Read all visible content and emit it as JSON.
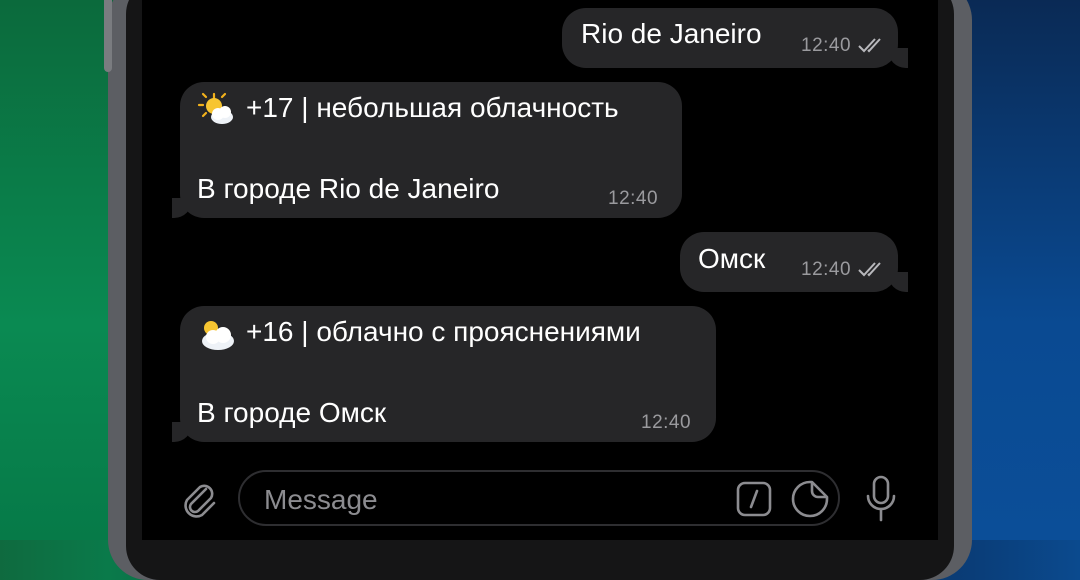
{
  "chat": {
    "messages": [
      {
        "direction": "out",
        "text": "Rio de Janeiro",
        "time": "12:40",
        "status": "read"
      },
      {
        "direction": "in",
        "line1": "+17 | небольшая облачность",
        "line2": "В городе Rio de Janeiro",
        "time": "12:40",
        "emoji_icon": "sun-behind-cloud-icon"
      },
      {
        "direction": "out",
        "text": "Омск",
        "time": "12:40",
        "status": "read"
      },
      {
        "direction": "in",
        "line1": "+16 | облачно с прояснениями",
        "line2": "В городе Омск",
        "time": "12:40",
        "emoji_icon": "sun-behind-large-cloud-icon"
      }
    ]
  },
  "composer": {
    "placeholder": "Message",
    "icons": [
      "paperclip-icon",
      "bot-command-icon",
      "sticker-icon",
      "microphone-icon"
    ]
  },
  "colors": {
    "bubble": "#262628",
    "screen": "#000000",
    "time": "#9a9a9e",
    "placeholder": "#8c8c90"
  }
}
